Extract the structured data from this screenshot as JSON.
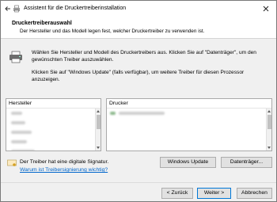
{
  "titlebar": {
    "title": "Assistent für die Druckertreiberinstallation"
  },
  "header": {
    "title": "Druckertreiberauswahl",
    "subtitle": "Der Hersteller und das Modell legen fest, welcher Druckertreiber zu verwenden ist."
  },
  "intro": {
    "line1": "Wählen Sie Hersteller und Modell des Druckertreibers aus. Klicken Sie auf \"Datenträger\", um den gewünschten Treiber auszuwählen.",
    "line2": "Klicken Sie auf \"Windows Update\" (falls verfügbar), um weitere Treiber für diesen Prozessor anzuzeigen."
  },
  "manufacturer_list": {
    "header": "Hersteller"
  },
  "printer_list": {
    "header": "Drucker"
  },
  "signature": {
    "text": "Der Treiber hat eine digitale Signatur.",
    "link": "Warum ist Treibersignierung wichtig?"
  },
  "buttons": {
    "windows_update": "Windows Update",
    "have_disk": "Datenträger...",
    "back": "< Zurück",
    "next": "Weiter >",
    "cancel": "Abbrechen"
  }
}
